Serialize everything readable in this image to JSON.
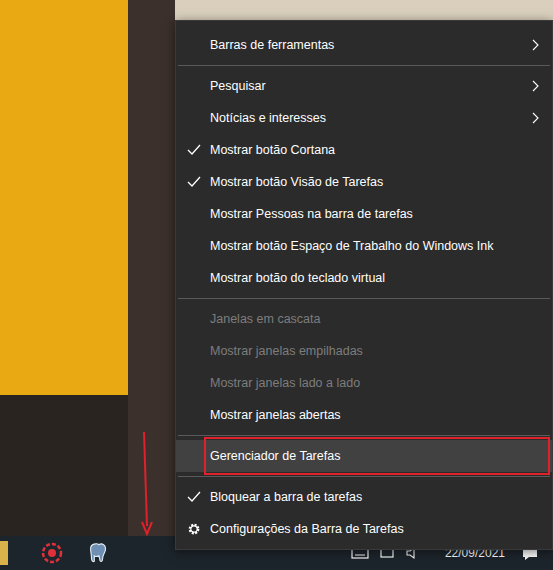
{
  "menu": {
    "groups": [
      {
        "items": [
          {
            "kind": "option",
            "label": "Barras de ferramentas",
            "checked": false,
            "disabled": false,
            "submenu": true,
            "selected": false,
            "marked": false
          }
        ]
      },
      {
        "items": [
          {
            "kind": "option",
            "label": "Pesquisar",
            "checked": false,
            "disabled": false,
            "submenu": true,
            "selected": false,
            "marked": false
          },
          {
            "kind": "option",
            "label": "Notícias e interesses",
            "checked": false,
            "disabled": false,
            "submenu": true,
            "selected": false,
            "marked": false
          },
          {
            "kind": "option",
            "label": "Mostrar botão Cortana",
            "checked": true,
            "disabled": false,
            "submenu": false,
            "selected": false,
            "marked": false
          },
          {
            "kind": "option",
            "label": "Mostrar botão Visão de Tarefas",
            "checked": true,
            "disabled": false,
            "submenu": false,
            "selected": false,
            "marked": false
          },
          {
            "kind": "option",
            "label": "Mostrar Pessoas na barra de tarefas",
            "checked": false,
            "disabled": false,
            "submenu": false,
            "selected": false,
            "marked": false
          },
          {
            "kind": "option",
            "label": "Mostrar botão Espaço de Trabalho do Windows Ink",
            "checked": false,
            "disabled": false,
            "submenu": false,
            "selected": false,
            "marked": false
          },
          {
            "kind": "option",
            "label": "Mostrar botão do teclado virtual",
            "checked": false,
            "disabled": false,
            "submenu": false,
            "selected": false,
            "marked": false
          }
        ]
      },
      {
        "items": [
          {
            "kind": "option",
            "label": "Janelas em cascata",
            "checked": false,
            "disabled": true,
            "submenu": false,
            "selected": false,
            "marked": false
          },
          {
            "kind": "option",
            "label": "Mostrar janelas empilhadas",
            "checked": false,
            "disabled": true,
            "submenu": false,
            "selected": false,
            "marked": false
          },
          {
            "kind": "option",
            "label": "Mostrar janelas lado a lado",
            "checked": false,
            "disabled": true,
            "submenu": false,
            "selected": false,
            "marked": false
          },
          {
            "kind": "option",
            "label": "Mostrar janelas abertas",
            "checked": false,
            "disabled": false,
            "submenu": false,
            "selected": false,
            "marked": false
          }
        ]
      },
      {
        "items": [
          {
            "kind": "option",
            "label": "Gerenciador de Tarefas",
            "checked": false,
            "disabled": false,
            "submenu": false,
            "selected": true,
            "marked": true
          }
        ]
      },
      {
        "items": [
          {
            "kind": "option",
            "label": "Bloquear a barra de tarefas",
            "checked": true,
            "disabled": false,
            "submenu": false,
            "selected": false,
            "marked": false
          },
          {
            "kind": "settings",
            "label": "Configurações da Barra de Tarefas",
            "checked": false,
            "disabled": false,
            "submenu": false,
            "selected": false,
            "marked": false
          }
        ]
      }
    ]
  },
  "taskbar": {
    "date": "22/09/2021"
  }
}
